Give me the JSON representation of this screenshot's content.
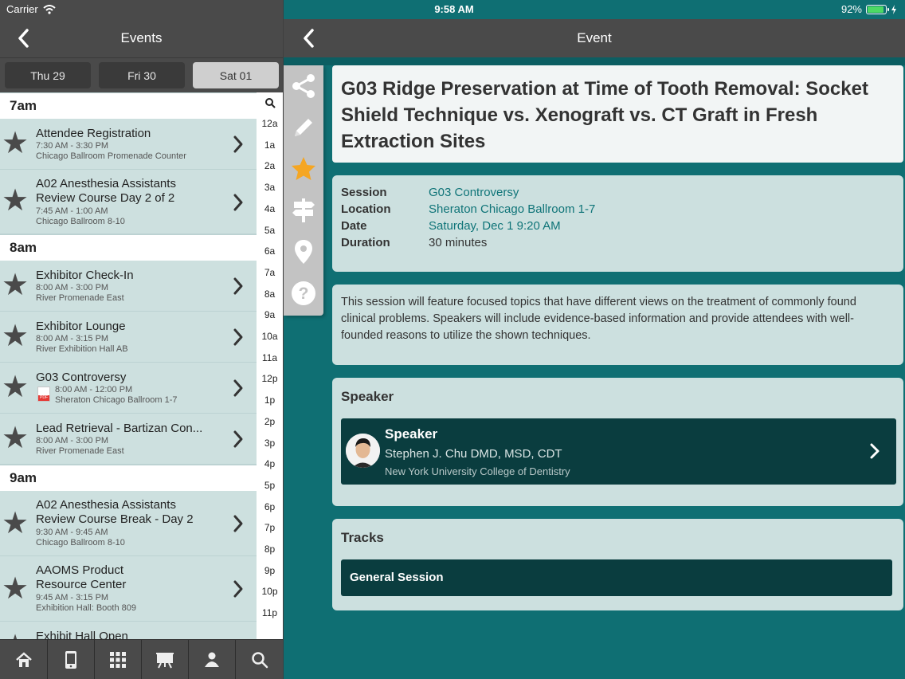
{
  "status": {
    "carrier": "Carrier",
    "time": "9:58 AM",
    "battery": "92%",
    "battery_level": 0.92
  },
  "left_nav": {
    "title": "Events"
  },
  "days": [
    {
      "label": "Thu 29",
      "selected": false
    },
    {
      "label": "Fri 30",
      "selected": false
    },
    {
      "label": "Sat 01",
      "selected": true
    }
  ],
  "hours": {
    "h7": "7am",
    "h8": "8am",
    "h9": "9am"
  },
  "events": [
    {
      "title": "Attendee Registration",
      "time": "7:30 AM - 3:30 PM",
      "location": "Chicago Ballroom Promenade Counter"
    },
    {
      "title": "A02 Anesthesia Assistants Review Course Day 2 of 2",
      "time": "7:45 AM - 1:00 AM",
      "location": "Chicago Ballroom 8-10"
    },
    {
      "title": "Exhibitor Check-In",
      "time": "8:00 AM - 3:00 PM",
      "location": "River Promenade East"
    },
    {
      "title": "Exhibitor Lounge",
      "time": "8:00 AM - 3:15 PM",
      "location": "River Exhibition Hall AB"
    },
    {
      "title": "G03 Controversy",
      "time": "8:00 AM - 12:00 PM",
      "location": "Sheraton Chicago Ballroom 1-7"
    },
    {
      "title": "Lead Retrieval - Bartizan Con...",
      "time": "8:00 AM - 3:00 PM",
      "location": "River Promenade East"
    },
    {
      "title": "A02 Anesthesia Assistants Review Course Break - Day 2",
      "time": "9:30 AM - 9:45 AM",
      "location": "Chicago Ballroom 8-10"
    },
    {
      "title": "AAOMS Product Resource Center",
      "time": "9:45 AM - 3:15 PM",
      "location": "Exhibition Hall: Booth 809"
    },
    {
      "title": "Exhibit Hall Open",
      "time": "",
      "location": ""
    }
  ],
  "hour_index": [
    "12a",
    "1a",
    "2a",
    "3a",
    "4a",
    "5a",
    "6a",
    "7a",
    "8a",
    "9a",
    "10a",
    "11a",
    "12p",
    "1p",
    "2p",
    "3p",
    "4p",
    "5p",
    "6p",
    "7p",
    "8p",
    "9p",
    "10p",
    "11p"
  ],
  "tabs": [
    "home-icon",
    "phone-icon",
    "grid-icon",
    "presentation-icon",
    "person-icon",
    "search-icon"
  ],
  "right_nav": {
    "title": "Event"
  },
  "toolbar": [
    "share-icon",
    "pencil-icon",
    "star-icon",
    "signpost-icon",
    "map-pin-icon",
    "help-icon"
  ],
  "event": {
    "title": "G03 Ridge Preservation at Time of Tooth Removal: Socket Shield Technique vs. Xenograft vs. CT Graft in Fresh Extraction Sites",
    "session_label": "Session",
    "session": "G03 Controversy",
    "location_label": "Location",
    "location": "Sheraton Chicago Ballroom 1-7",
    "date_label": "Date",
    "date": "Saturday, Dec 1 9:20 AM",
    "duration_label": "Duration",
    "duration": "30 minutes",
    "description": "This session will feature focused topics that have different views on the treatment of commonly found clinical problems. Speakers will include evidence-based information and provide attendees with well-founded reasons to utilize the shown techniques."
  },
  "speaker_section": {
    "heading": "Speaker",
    "row_heading": "Speaker",
    "name": "Stephen J. Chu DMD, MSD, CDT",
    "affiliation": "New York University College of Dentistry"
  },
  "tracks_section": {
    "heading": "Tracks",
    "items": [
      "General Session"
    ]
  },
  "colors": {
    "teal": "#0f6f73",
    "dark_teal": "#0a3d3f",
    "link": "#0f7478",
    "star_selected": "#f5a623"
  }
}
